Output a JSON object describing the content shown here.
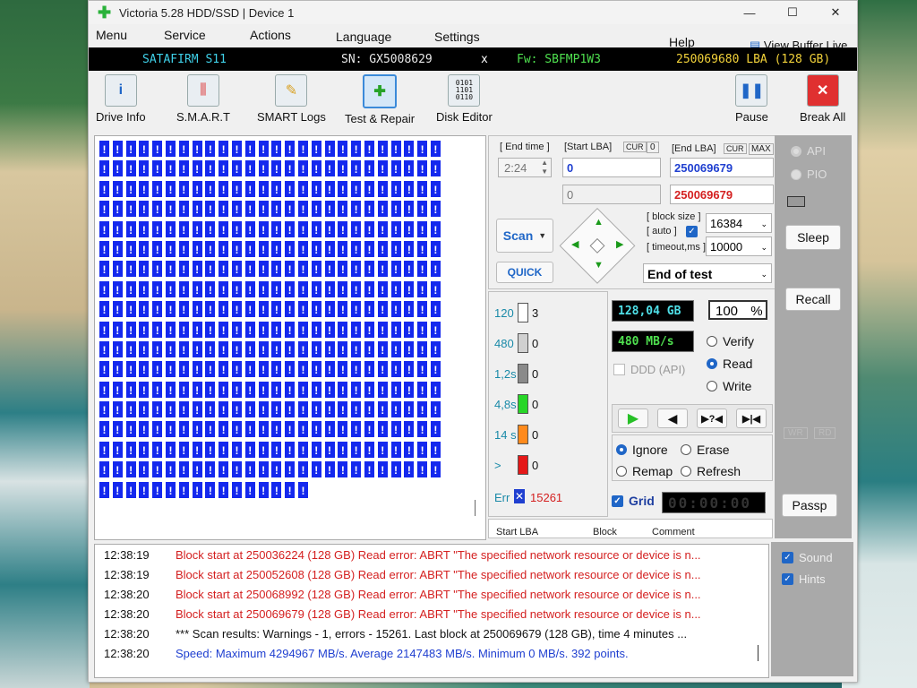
{
  "window": {
    "title": "Victoria 5.28 HDD/SSD | Device 1",
    "minimize": "—",
    "maximize": "☐",
    "close": "✕"
  },
  "menu": {
    "items": [
      "Menu",
      "Service",
      "Actions",
      "Language",
      "Settings",
      "Help"
    ],
    "view_buffer": "View Buffer Live"
  },
  "drive_bar": {
    "model": "SATAFIRM   S11",
    "serial": "SN: GX5008629",
    "close": "x",
    "firmware": "Fw: SBFMP1W3",
    "capacity": "250069680 LBA (128 GB)"
  },
  "toolbar": {
    "buttons": [
      {
        "label": "Drive Info",
        "icon": "info-icon"
      },
      {
        "label": "S.M.A.R.T",
        "icon": "smart-icon"
      },
      {
        "label": "SMART Logs",
        "icon": "logs-icon"
      },
      {
        "label": "Test & Repair",
        "icon": "repair-icon"
      },
      {
        "label": "Disk Editor",
        "icon": "binary-icon"
      }
    ],
    "pause": "Pause",
    "break_all": "Break All"
  },
  "scan": {
    "end_time_label": "[ End time ]",
    "end_time_value": "2:24",
    "start_lba_label": "[Start LBA]",
    "cur_label": "CUR",
    "cur_value": "0",
    "start_lba": "0",
    "start_lba_2": "0",
    "end_lba_label": "[End LBA]",
    "end_cur_label": "CUR",
    "max_label": "MAX",
    "end_lba": "250069679",
    "end_lba_2": "250069679",
    "scan_button": "Scan",
    "quick_button": "QUICK",
    "block_size_label": "[ block size ]",
    "auto_label": "[ auto ]",
    "block_size": "16384",
    "timeout_label": "[ timeout,ms ]",
    "timeout": "10000",
    "end_action": "End of test"
  },
  "stats": {
    "rows": [
      {
        "label": "120",
        "count": "3",
        "color": "#ffffff"
      },
      {
        "label": "480",
        "count": "0",
        "color": "#d0d0d0"
      },
      {
        "label": "1,2s",
        "count": "0",
        "color": "#8a8a8a"
      },
      {
        "label": "4,8s",
        "count": "0",
        "color": "#27d627"
      },
      {
        "label": "14 s",
        "count": "0",
        "color": "#ff8a1c"
      },
      {
        "label": ">",
        "count": "0",
        "color": "#e51818"
      }
    ],
    "err_label": "Err",
    "err_count": "15261",
    "size": "128,04 GB",
    "percent": "100",
    "percent_sign": "%",
    "speed": "480 MB/s"
  },
  "mode": {
    "verify": "Verify",
    "read": "Read",
    "write": "Write",
    "ddd": "DDD (API)"
  },
  "transport": [
    "▶",
    "◀",
    "▶?◀",
    "▶|◀"
  ],
  "repair": {
    "ignore": "Ignore",
    "erase": "Erase",
    "remap": "Remap",
    "refresh": "Refresh"
  },
  "grid_label": "Grid",
  "timer": "00:00:00",
  "table_headers": [
    "Start LBA",
    "Block",
    "Comment"
  ],
  "sidebar": {
    "api": "API",
    "pio": "PIO",
    "sleep": "Sleep",
    "recall": "Recall",
    "wr": "WR",
    "rd": "RD",
    "passp": "Passp",
    "sound": "Sound",
    "hints": "Hints"
  },
  "log": [
    {
      "time": "12:38:19",
      "text": "Block start at 250036224 (128 GB) Read error: ABRT \"The specified network resource or device is n...",
      "color": "#d42020"
    },
    {
      "time": "12:38:19",
      "text": "Block start at 250052608 (128 GB) Read error: ABRT \"The specified network resource or device is n...",
      "color": "#d42020"
    },
    {
      "time": "12:38:20",
      "text": "Block start at 250068992 (128 GB) Read error: ABRT \"The specified network resource or device is n...",
      "color": "#d42020"
    },
    {
      "time": "12:38:20",
      "text": "Block start at 250069679 (128 GB) Read error: ABRT \"The specified network resource or device is n...",
      "color": "#d42020"
    },
    {
      "time": "12:38:20",
      "text": "*** Scan results: Warnings - 1, errors - 15261. Last block at 250069679 (128 GB), time 4 minutes ...",
      "color": "#111111"
    },
    {
      "time": "12:38:20",
      "text": "Speed: Maximum 4294967 MB/s. Average 2147483 MB/s. Minimum 0 MB/s. 392 points.",
      "color": "#1f3fd0"
    }
  ],
  "map": {
    "cell_symbol": "!",
    "full_cells": 442,
    "last_row_cells": 16
  }
}
